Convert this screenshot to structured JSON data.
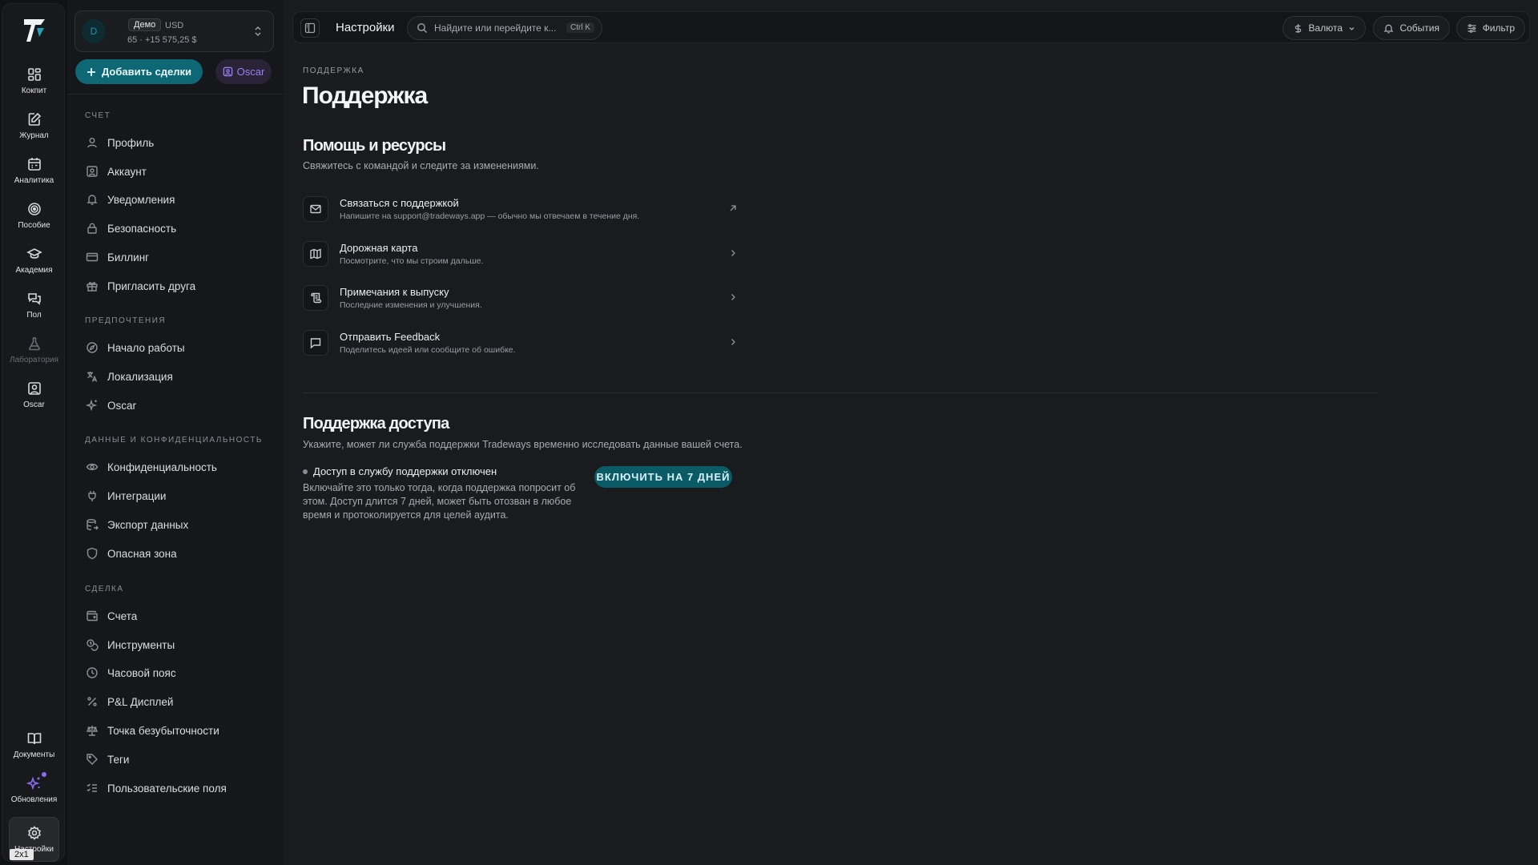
{
  "rail": {
    "items": [
      {
        "label": "Кокпит",
        "icon": "grid-icon"
      },
      {
        "label": "Журнал",
        "icon": "journal-icon"
      },
      {
        "label": "Аналитика",
        "icon": "calendar-icon"
      },
      {
        "label": "Пособие",
        "icon": "target-icon"
      },
      {
        "label": "Академия",
        "icon": "graduation-cap-icon"
      },
      {
        "label": "Пол",
        "icon": "chat-icon"
      },
      {
        "label": "Лаборатория",
        "icon": "flask-icon",
        "disabled": true
      },
      {
        "label": "Oscar",
        "icon": "oscar-icon"
      }
    ],
    "bottom": [
      {
        "label": "Документы",
        "icon": "book-icon"
      },
      {
        "label": "Обновления",
        "icon": "sparkles-icon"
      },
      {
        "label": "Настройки",
        "icon": "gear-icon",
        "active": true
      }
    ],
    "zoom_badge": "2x1"
  },
  "account": {
    "avatar": "D",
    "badge": "Демо",
    "currency": "USD",
    "balance": "65 · +15 575,25 $"
  },
  "sidebar": {
    "add_button": "Добавить сделки",
    "oscar_button": "Oscar",
    "sections": [
      {
        "title": "Счет",
        "items": [
          "Профиль",
          "Аккаунт",
          "Уведомления",
          "Безопасность",
          "Биллинг",
          "Пригласить друга"
        ]
      },
      {
        "title": "Предпочтения",
        "items": [
          "Начало работы",
          "Локализация",
          "Oscar"
        ]
      },
      {
        "title": "Данные и конфиденциальность",
        "items": [
          "Конфиденциальность",
          "Интеграции",
          "Экспорт данных",
          "Опасная зона"
        ]
      },
      {
        "title": "Сделка",
        "items": [
          "Счета",
          "Инструменты",
          "Часовой пояс",
          "P&L Дисплей",
          "Точка безубыточности",
          "Теги",
          "Пользовательские поля"
        ]
      }
    ]
  },
  "topbar": {
    "title": "Настройки",
    "search_placeholder": "Найдите или перейдите к...",
    "search_shortcut": "Ctrl K",
    "currency": "Валюта",
    "events": "События",
    "filter": "Фильтр"
  },
  "page": {
    "breadcrumb": "ПОДДЕРЖКА",
    "title": "Поддержка",
    "help": {
      "title": "Помощь и ресурсы",
      "subtitle": "Свяжитесь с командой и следите за изменениями.",
      "items": [
        {
          "title": "Связаться с поддержкой",
          "desc": "Напишите на support@tradeways.app — обычно мы отвечаем в течение дня.",
          "icon": "mail-icon",
          "arrow": "external-link-icon"
        },
        {
          "title": "Дорожная карта",
          "desc": "Посмотрите, что мы строим дальше.",
          "icon": "map-icon",
          "arrow": "chevron-right-icon"
        },
        {
          "title": "Примечания к выпуску",
          "desc": "Последние изменения и улучшения.",
          "icon": "scroll-icon",
          "arrow": "chevron-right-icon"
        },
        {
          "title": "Отправить Feedback",
          "desc": "Поделитесь идеей или сообщите об ошибке.",
          "icon": "message-square-icon",
          "arrow": "chevron-right-icon"
        }
      ]
    },
    "access": {
      "title": "Поддержка доступа",
      "subtitle": "Укажите, может ли служба поддержки Tradeways временно исследовать данные вашей счета.",
      "status": "Доступ в службу поддержки отключен",
      "desc": "Включайте это только тогда, когда поддержка попросит об этом. Доступ длится 7 дней, может быть отозван в любое время и протоколируется для целей аудита.",
      "button": "ВКЛЮЧИТЬ НА 7 ДНЕЙ"
    }
  }
}
